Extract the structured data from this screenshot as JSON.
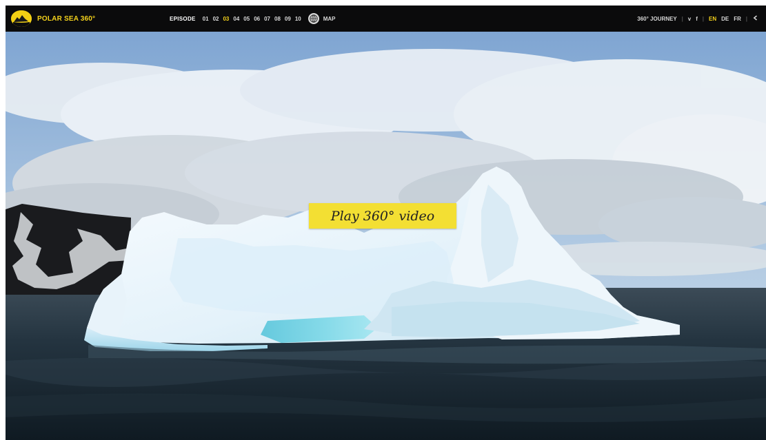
{
  "brand": {
    "name": "POLAR SEA 360°"
  },
  "nav": {
    "episode_label": "EPISODE",
    "episodes": [
      "01",
      "02",
      "03",
      "04",
      "05",
      "06",
      "07",
      "08",
      "09",
      "10"
    ],
    "active_episode": "03",
    "map_label": "MAP",
    "journey_label": "360° JOURNEY",
    "social": [
      "v",
      "f"
    ],
    "languages": [
      "EN",
      "DE",
      "FR"
    ],
    "active_language": "EN",
    "back_icon": "arrow-left-icon"
  },
  "hero": {
    "play_label": "Play 360° video"
  },
  "colors": {
    "accent": "#f4d21c",
    "bar": "#0b0b0c",
    "play_button": "#f3df33"
  }
}
